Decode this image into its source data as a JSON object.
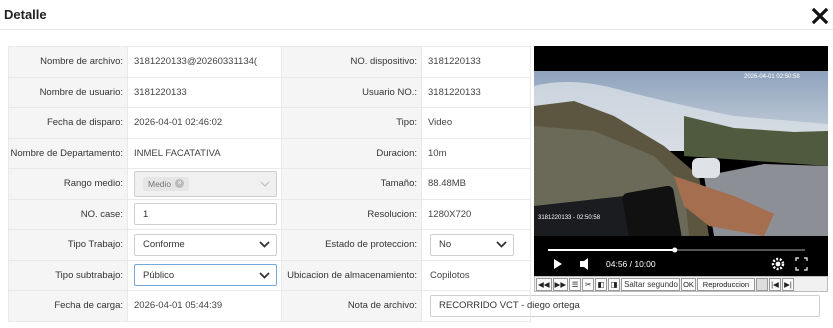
{
  "dialog": {
    "title": "Detalle"
  },
  "fields": {
    "nombre_archivo": {
      "label": "Nombre de archivo:",
      "value": "3181220133@20260331134("
    },
    "no_dispositivo": {
      "label": "NO. dispositivo:",
      "value": "3181220133"
    },
    "nombre_usuario": {
      "label": "Nombre de usuario:",
      "value": "3181220133"
    },
    "usuario_no": {
      "label": "Usuario NO.:",
      "value": "3181220133"
    },
    "fecha_disparo": {
      "label": "Fecha de disparo:",
      "value": "2026-04-01 02:46:02"
    },
    "tipo": {
      "label": "Tipo:",
      "value": "Video"
    },
    "departamento": {
      "label": "Nombre de Departamento:",
      "value": "INMEL FACATATIVA"
    },
    "duracion": {
      "label": "Duracion:",
      "value": "10m"
    },
    "rango_medio": {
      "label": "Rango medio:",
      "tag": "Medio"
    },
    "tamano": {
      "label": "Tamaño:",
      "value": "88.48MB"
    },
    "no_case": {
      "label": "NO. case:",
      "value": "1"
    },
    "resolucion": {
      "label": "Resolucion:",
      "value": "1280X720"
    },
    "tipo_trabajo": {
      "label": "Tipo Trabajo:",
      "value": "Conforme"
    },
    "estado_proteccion": {
      "label": "Estado de proteccion:",
      "value": "No"
    },
    "tipo_subtrabajo": {
      "label": "Tipo subtrabajo:",
      "value": "Público"
    },
    "ubicacion": {
      "label": "Ubicacion de almacenamiento:",
      "value": "Copilotos"
    },
    "fecha_carga": {
      "label": "Fecha de carga:",
      "value": "2026-04-01 05:44:39"
    },
    "nota_archivo": {
      "label": "Nota de archivo:",
      "value": "RECORRIDO VCT - diego ortega"
    }
  },
  "player": {
    "time": "04:56 / 10:00",
    "progress": 0.493,
    "overlay_top": "2026-04-01 02:50:58",
    "overlay_left": "3181220133 - 02:50:58"
  },
  "toolbar": {
    "jump_placeholder": "Saltar segundo",
    "ok_label": "OK",
    "speed_label": "Reproduccion"
  }
}
